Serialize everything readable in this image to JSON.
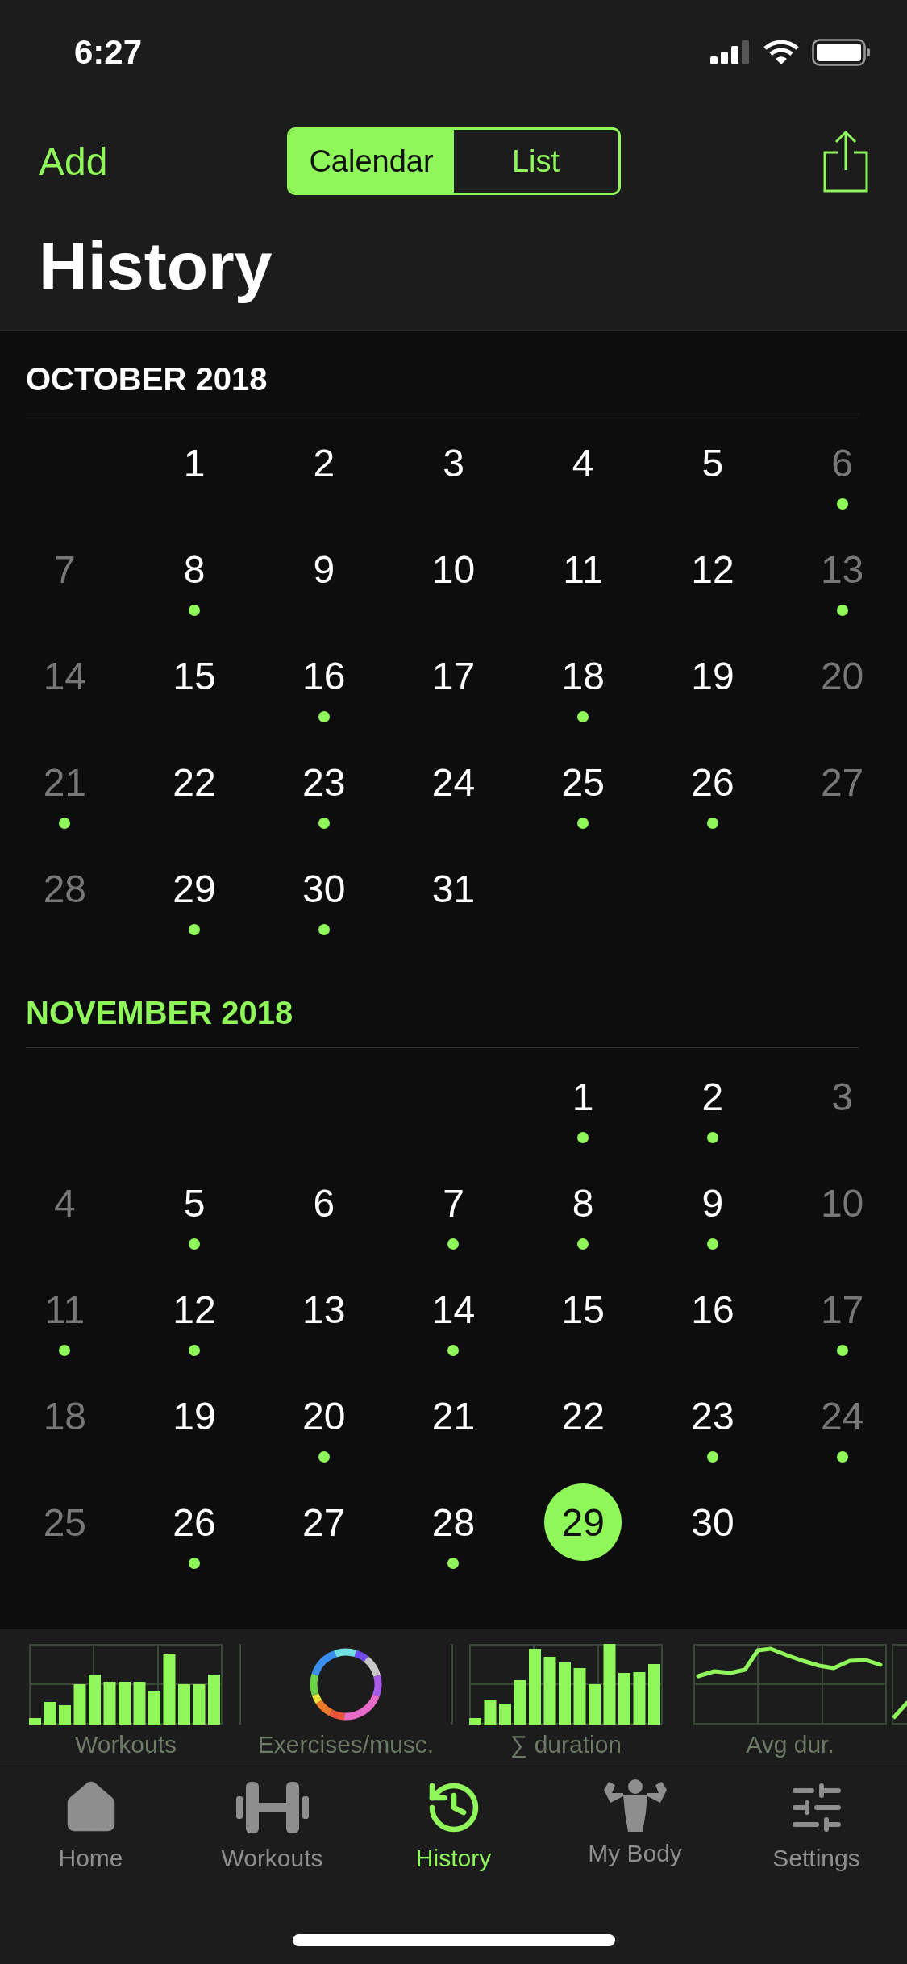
{
  "status_bar": {
    "time": "6:27"
  },
  "nav": {
    "add": "Add",
    "segments": [
      {
        "label": "Calendar",
        "selected": true
      },
      {
        "label": "List",
        "selected": false
      }
    ],
    "title": "History"
  },
  "months": [
    {
      "title": "OCTOBER 2018",
      "current": false,
      "weeks": [
        [
          {
            "kind": "blank"
          },
          {
            "kind": "day",
            "day": "1",
            "workout": false,
            "selected": false
          },
          {
            "kind": "day",
            "day": "2",
            "workout": false,
            "selected": false
          },
          {
            "kind": "day",
            "day": "3",
            "workout": false,
            "selected": false
          },
          {
            "kind": "day",
            "day": "4",
            "workout": false,
            "selected": false
          },
          {
            "kind": "day",
            "day": "5",
            "workout": false,
            "selected": false
          },
          {
            "kind": "day",
            "day": "6",
            "workout": true,
            "selected": false
          }
        ],
        [
          {
            "kind": "day",
            "day": "7",
            "workout": false,
            "selected": false
          },
          {
            "kind": "day",
            "day": "8",
            "workout": true,
            "selected": false
          },
          {
            "kind": "day",
            "day": "9",
            "workout": false,
            "selected": false
          },
          {
            "kind": "day",
            "day": "10",
            "workout": false,
            "selected": false
          },
          {
            "kind": "day",
            "day": "11",
            "workout": false,
            "selected": false
          },
          {
            "kind": "day",
            "day": "12",
            "workout": false,
            "selected": false
          },
          {
            "kind": "day",
            "day": "13",
            "workout": true,
            "selected": false
          }
        ],
        [
          {
            "kind": "day",
            "day": "14",
            "workout": false,
            "selected": false
          },
          {
            "kind": "day",
            "day": "15",
            "workout": false,
            "selected": false
          },
          {
            "kind": "day",
            "day": "16",
            "workout": true,
            "selected": false
          },
          {
            "kind": "day",
            "day": "17",
            "workout": false,
            "selected": false
          },
          {
            "kind": "day",
            "day": "18",
            "workout": true,
            "selected": false
          },
          {
            "kind": "day",
            "day": "19",
            "workout": false,
            "selected": false
          },
          {
            "kind": "day",
            "day": "20",
            "workout": false,
            "selected": false
          }
        ],
        [
          {
            "kind": "day",
            "day": "21",
            "workout": true,
            "selected": false
          },
          {
            "kind": "day",
            "day": "22",
            "workout": false,
            "selected": false
          },
          {
            "kind": "day",
            "day": "23",
            "workout": true,
            "selected": false
          },
          {
            "kind": "day",
            "day": "24",
            "workout": false,
            "selected": false
          },
          {
            "kind": "day",
            "day": "25",
            "workout": true,
            "selected": false
          },
          {
            "kind": "day",
            "day": "26",
            "workout": true,
            "selected": false
          },
          {
            "kind": "day",
            "day": "27",
            "workout": false,
            "selected": false
          }
        ],
        [
          {
            "kind": "day",
            "day": "28",
            "workout": false,
            "selected": false
          },
          {
            "kind": "day",
            "day": "29",
            "workout": true,
            "selected": false
          },
          {
            "kind": "day",
            "day": "30",
            "workout": true,
            "selected": false
          },
          {
            "kind": "day",
            "day": "31",
            "workout": false,
            "selected": false
          },
          {
            "kind": "blank"
          },
          {
            "kind": "blank"
          },
          {
            "kind": "blank"
          }
        ]
      ]
    },
    {
      "title": "NOVEMBER 2018",
      "current": true,
      "weeks": [
        [
          {
            "kind": "blank"
          },
          {
            "kind": "blank"
          },
          {
            "kind": "blank"
          },
          {
            "kind": "blank"
          },
          {
            "kind": "day",
            "day": "1",
            "workout": true,
            "selected": false
          },
          {
            "kind": "day",
            "day": "2",
            "workout": true,
            "selected": false
          },
          {
            "kind": "day",
            "day": "3",
            "workout": false,
            "selected": false
          }
        ],
        [
          {
            "kind": "day",
            "day": "4",
            "workout": false,
            "selected": false
          },
          {
            "kind": "day",
            "day": "5",
            "workout": true,
            "selected": false
          },
          {
            "kind": "day",
            "day": "6",
            "workout": false,
            "selected": false
          },
          {
            "kind": "day",
            "day": "7",
            "workout": true,
            "selected": false
          },
          {
            "kind": "day",
            "day": "8",
            "workout": true,
            "selected": false
          },
          {
            "kind": "day",
            "day": "9",
            "workout": true,
            "selected": false
          },
          {
            "kind": "day",
            "day": "10",
            "workout": false,
            "selected": false
          }
        ],
        [
          {
            "kind": "day",
            "day": "11",
            "workout": true,
            "selected": false
          },
          {
            "kind": "day",
            "day": "12",
            "workout": true,
            "selected": false
          },
          {
            "kind": "day",
            "day": "13",
            "workout": false,
            "selected": false
          },
          {
            "kind": "day",
            "day": "14",
            "workout": true,
            "selected": false
          },
          {
            "kind": "day",
            "day": "15",
            "workout": false,
            "selected": false
          },
          {
            "kind": "day",
            "day": "16",
            "workout": false,
            "selected": false
          },
          {
            "kind": "day",
            "day": "17",
            "workout": true,
            "selected": false
          }
        ],
        [
          {
            "kind": "day",
            "day": "18",
            "workout": false,
            "selected": false
          },
          {
            "kind": "day",
            "day": "19",
            "workout": false,
            "selected": false
          },
          {
            "kind": "day",
            "day": "20",
            "workout": true,
            "selected": false
          },
          {
            "kind": "day",
            "day": "21",
            "workout": false,
            "selected": false
          },
          {
            "kind": "day",
            "day": "22",
            "workout": false,
            "selected": false
          },
          {
            "kind": "day",
            "day": "23",
            "workout": true,
            "selected": false
          },
          {
            "kind": "day",
            "day": "24",
            "workout": true,
            "selected": false
          }
        ],
        [
          {
            "kind": "day",
            "day": "25",
            "workout": false,
            "selected": false
          },
          {
            "kind": "day",
            "day": "26",
            "workout": true,
            "selected": false
          },
          {
            "kind": "day",
            "day": "27",
            "workout": false,
            "selected": false
          },
          {
            "kind": "day",
            "day": "28",
            "workout": true,
            "selected": false
          },
          {
            "kind": "day",
            "day": "29",
            "workout": false,
            "selected": true
          },
          {
            "kind": "day",
            "day": "30",
            "workout": false,
            "selected": false
          },
          {
            "kind": "blank"
          }
        ]
      ]
    }
  ],
  "charts": [
    {
      "kind": "bar",
      "label": "Workouts"
    },
    {
      "kind": "ring",
      "label": "Exercises/musc."
    },
    {
      "kind": "bar",
      "label": "∑ duration"
    },
    {
      "kind": "line",
      "label": "Avg dur."
    }
  ],
  "tabs": [
    {
      "kind": "home",
      "label": "Home",
      "selected": false
    },
    {
      "kind": "workouts",
      "label": "Workouts",
      "selected": false
    },
    {
      "kind": "history",
      "label": "History",
      "selected": true
    },
    {
      "kind": "body",
      "label": "My Body",
      "selected": false
    },
    {
      "kind": "settings",
      "label": "Settings",
      "selected": false
    }
  ]
}
